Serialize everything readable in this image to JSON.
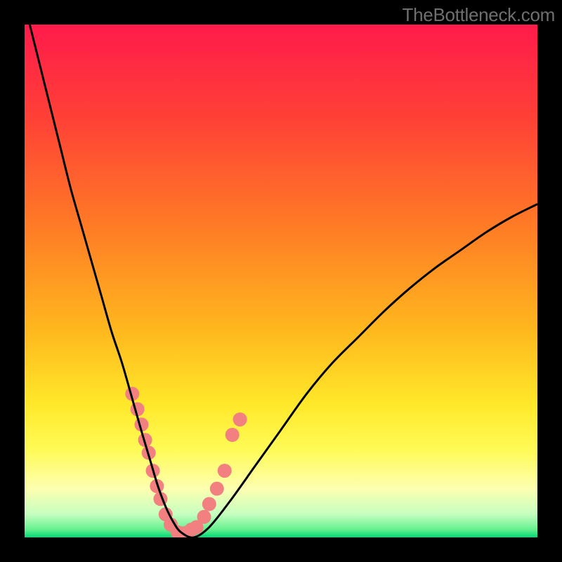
{
  "watermark": "TheBottleneck.com",
  "chart_data": {
    "type": "line",
    "title": "",
    "xlabel": "",
    "ylabel": "",
    "xlim": [
      0,
      100
    ],
    "ylim": [
      0,
      100
    ],
    "grid": false,
    "legend": false,
    "gradient_stops": [
      {
        "offset": 0,
        "color": "#ff1b4b"
      },
      {
        "offset": 0.18,
        "color": "#ff4037"
      },
      {
        "offset": 0.4,
        "color": "#ff7d25"
      },
      {
        "offset": 0.6,
        "color": "#ffb91e"
      },
      {
        "offset": 0.74,
        "color": "#ffe82a"
      },
      {
        "offset": 0.83,
        "color": "#fffb57"
      },
      {
        "offset": 0.905,
        "color": "#fdffb0"
      },
      {
        "offset": 0.955,
        "color": "#c5ffc0"
      },
      {
        "offset": 0.985,
        "color": "#64f08e"
      },
      {
        "offset": 1.0,
        "color": "#00d977"
      }
    ],
    "series": [
      {
        "name": "bottleneck-curve",
        "color": "#000000",
        "x": [
          1,
          3,
          5,
          7,
          9,
          11,
          13,
          15,
          17,
          19,
          21,
          23,
          24.5,
          26,
          27.5,
          29,
          30.5,
          33,
          36,
          40,
          45,
          50,
          55,
          60,
          65,
          70,
          75,
          80,
          85,
          90,
          95,
          100
        ],
        "y": [
          100,
          92,
          84,
          76,
          68,
          61,
          54,
          47,
          40,
          34,
          27,
          20,
          15,
          10,
          6,
          3,
          1,
          0,
          2,
          7,
          14,
          21,
          28,
          34,
          39,
          44,
          48.5,
          52.5,
          56,
          59.5,
          62.5,
          65
        ]
      }
    ],
    "scatter": {
      "name": "datapoints",
      "color": "#f28080",
      "radius": 10,
      "x": [
        21.0,
        22.0,
        22.8,
        23.5,
        24.2,
        25.0,
        25.8,
        26.5,
        27.5,
        28.5,
        29.8,
        31.0,
        31.8,
        32.5,
        33.5,
        35.0,
        36.0,
        37.5,
        39.0,
        40.5,
        42.0
      ],
      "y": [
        28.0,
        25.0,
        22.0,
        19.0,
        16.5,
        13.0,
        10.0,
        7.5,
        4.5,
        2.5,
        1.0,
        0.8,
        1.0,
        1.5,
        2.0,
        4.0,
        6.5,
        9.5,
        13.0,
        20.0,
        23.0
      ]
    }
  }
}
